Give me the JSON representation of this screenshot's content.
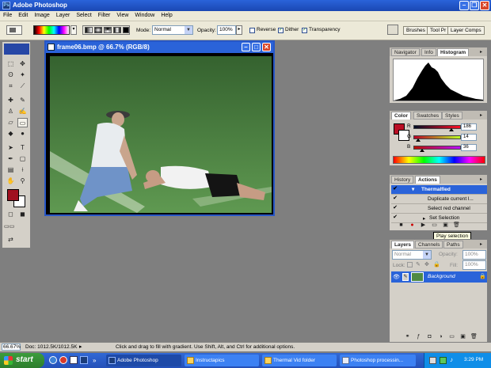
{
  "app": {
    "title": "Adobe Photoshop"
  },
  "menu": [
    "File",
    "Edit",
    "Image",
    "Layer",
    "Select",
    "Filter",
    "View",
    "Window",
    "Help"
  ],
  "options": {
    "mode_label": "Mode:",
    "mode_value": "Normal",
    "opacity_label": "Opacity:",
    "opacity_value": "100%",
    "reverse_label": "Reverse",
    "reverse_checked": false,
    "dither_label": "Dither",
    "dither_checked": true,
    "transparency_label": "Transparency",
    "transparency_checked": true,
    "wells": [
      "Brushes",
      "Tool Pr",
      "Layer Comps"
    ]
  },
  "document": {
    "title": "frame06.bmp @ 66.7% (RGB/8)"
  },
  "navigator": {
    "tabs": [
      "Navigator",
      "Info",
      "Histogram"
    ],
    "active": "Histogram"
  },
  "color_panel": {
    "tabs": [
      "Color",
      "Swatches",
      "Styles"
    ],
    "active": "Color",
    "channels": [
      {
        "label": "R",
        "value": "186",
        "fraction": 0.73
      },
      {
        "label": "G",
        "value": "14",
        "fraction": 0.05
      },
      {
        "label": "B",
        "value": "36",
        "fraction": 0.14
      }
    ],
    "foreground_color": "#ba0e24"
  },
  "actions_panel": {
    "tabs": [
      "History",
      "Actions"
    ],
    "active": "Actions",
    "rows": [
      {
        "label": "Thermalfied",
        "selected": true,
        "indent": 0
      },
      {
        "label": "Duplicate current l...",
        "selected": false,
        "indent": 1
      },
      {
        "label": "Select red channel",
        "selected": false,
        "indent": 1
      },
      {
        "label": "Set Selection",
        "selected": false,
        "indent": 1
      }
    ]
  },
  "tooltip": {
    "text": "Play selection"
  },
  "layers_panel": {
    "tabs": [
      "Layers",
      "Channels",
      "Paths"
    ],
    "active": "Layers",
    "blend_mode": "Normal",
    "opacity_label": "Opacity:",
    "opacity_value": "100%",
    "lock_label": "Lock:",
    "fill_label": "Fill:",
    "fill_value": "100%",
    "layers": [
      {
        "name": "Background",
        "selected": true
      }
    ]
  },
  "statusbar": {
    "zoom": "66.67%",
    "doc_info": "Doc: 1012.5K/1012.5K",
    "hint": "Click and drag to fill with gradient.  Use Shift, Alt, and Ctrl for additional options."
  },
  "taskbar": {
    "start_label": "start",
    "tasks": [
      "Adobe Photoshop",
      "Instructapics",
      "Thermal Vid folder",
      "Photoshop processin..."
    ],
    "active_task": "Adobe Photoshop",
    "clock": "3:29 PM"
  },
  "colors": {
    "accent": "#2a63d9",
    "panel_bg": "#d4d0c8",
    "workspace": "#7f7f7f"
  }
}
